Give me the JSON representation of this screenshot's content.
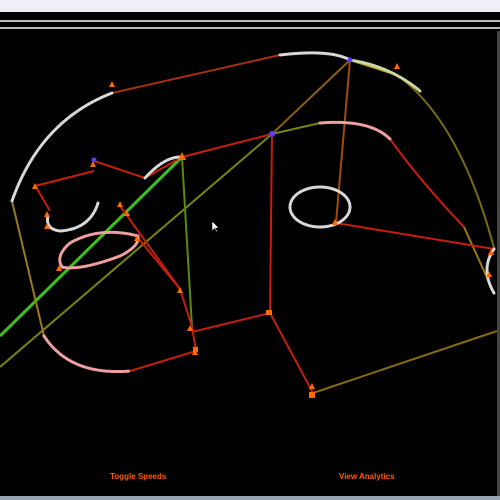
{
  "window": {
    "topbar_color": "#eef0f5",
    "rule_color": "#b8b8b8"
  },
  "toolbar": {
    "toggle_speeds_label": "Toggle Speeds",
    "view_analytics_label": "View Analytics",
    "button_color": "#ff5a00"
  },
  "track": {
    "background": "#000000",
    "link_colors": [
      "#c41e0e",
      "#9a5a10",
      "#7a8410",
      "#3cc01c"
    ],
    "track_dot_colors": [
      "#d8d8d8",
      "#f0a0a0",
      "#c8d8a0"
    ],
    "node_color": "#ff6a00",
    "junction_color": "#5a3cff"
  }
}
